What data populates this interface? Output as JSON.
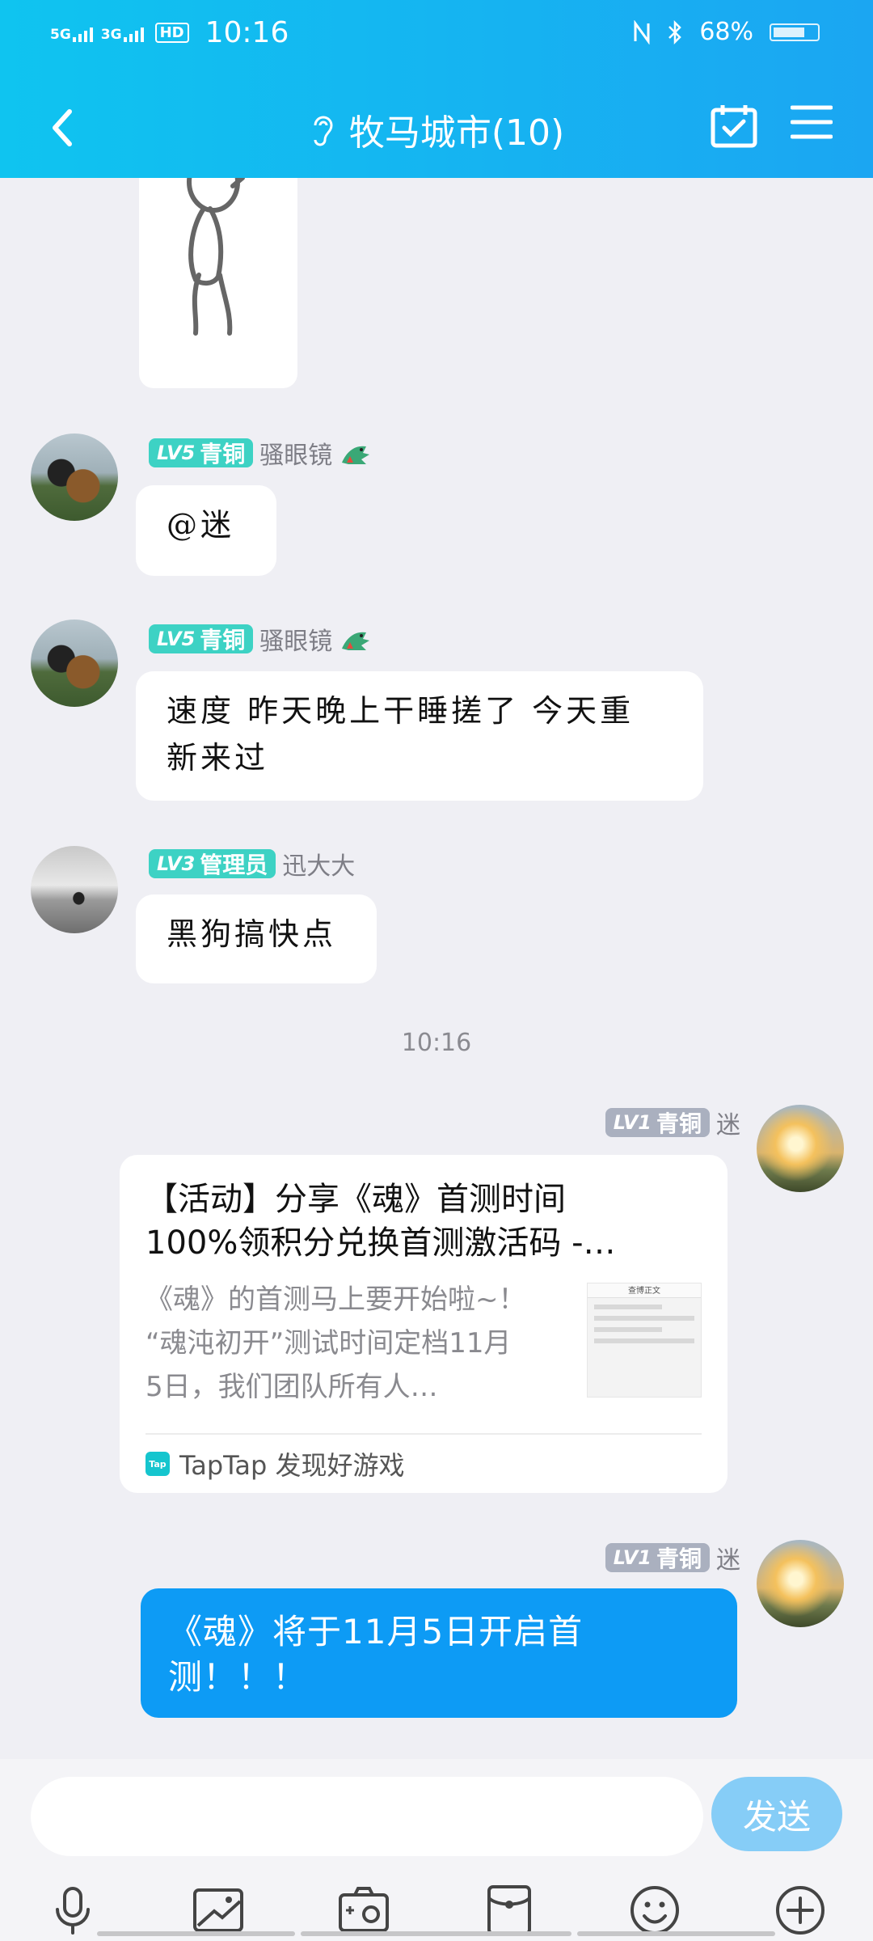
{
  "status_bar": {
    "network_1": "5G",
    "network_2": "3G",
    "hd": "HD",
    "time": "10:16",
    "battery": "68%",
    "icons": [
      "nfc-icon",
      "bluetooth-icon",
      "battery-icon"
    ]
  },
  "header": {
    "title": "牧马城市(10)",
    "back_icon": "chevron-left-icon",
    "ear_icon": "ear-icon",
    "calendar_icon": "calendar-check-icon",
    "menu_icon": "menu-icon"
  },
  "messages": [
    {
      "user": "骚眼镜",
      "level": "LV5",
      "rank": "青铜",
      "text": "@迷"
    },
    {
      "user": "骚眼镜",
      "level": "LV5",
      "rank": "青铜",
      "text_line1": "速度 昨天晚上干睡搓了 今天重",
      "text_line2": "新来过"
    },
    {
      "user": "迅大大",
      "level": "LV3",
      "rank": "管理员",
      "text": "黑狗搞快点"
    }
  ],
  "timestamp": "10:16",
  "share_card": {
    "user": "迷",
    "level": "LV1",
    "rank": "青铜",
    "title_line1": "【活动】分享《魂》首测时间",
    "title_line2": "100%领积分兑换首测激活码 -…",
    "desc_line1": "《魂》的首测马上要开始啦~！",
    "desc_line2": "“魂沌初开”测试时间定档11月",
    "desc_line3": "5日，我们团队所有人…",
    "thumb_header": "查博正文",
    "source_icon_text": "Tap",
    "source": "TapTap 发现好游戏"
  },
  "last_message": {
    "user": "迷",
    "level": "LV1",
    "rank": "青铜",
    "text_line1": "《魂》将于11月5日开启首",
    "text_line2": "测！！！"
  },
  "input": {
    "value": "",
    "placeholder": "",
    "send_label": "发送"
  },
  "toolbar_icons": [
    "microphone-icon",
    "image-icon",
    "camera-icon",
    "red-packet-icon",
    "emoji-icon",
    "plus-icon"
  ],
  "colors": {
    "header_start": "#0fc4f0",
    "header_end": "#1ba6f2",
    "bubble_self": "#0d9bf5",
    "badge_teal": "#3dd2c4",
    "badge_gray": "#aab0bf",
    "send_button": "#86cdf7",
    "background": "#efeff4"
  }
}
